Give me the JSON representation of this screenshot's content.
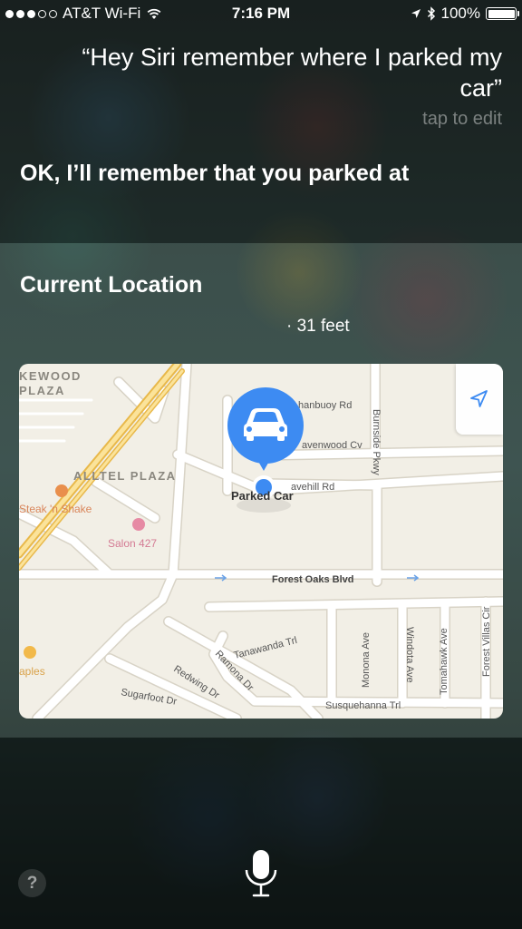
{
  "status_bar": {
    "carrier": "AT&T Wi-Fi",
    "time": "7:16 PM",
    "battery": "100%",
    "signal_bars_filled": 3,
    "signal_bars_total": 5
  },
  "siri": {
    "query": "“Hey Siri remember where I parked my car”",
    "tap_to_edit": "tap to edit",
    "response": "OK, I’ll remember that you parked at"
  },
  "card": {
    "title": "Current Location",
    "distance": "· 31 feet"
  },
  "map": {
    "labels": {
      "kewood": "KEWOOD",
      "plaza_partial": "PLAZA",
      "alltel_plaza": "ALLTEL PLAZA",
      "steak_n_shake": "Steak 'n Shake",
      "salon": "Salon 427",
      "staples_partial": "aples",
      "parked_car": "Parked Car",
      "hanbuoy": "hanbuoy Rd",
      "avenwood": "avenwood Cv",
      "avehill": "avehill Rd",
      "burnside": "Burnside Pkwy",
      "forest_oaks": "Forest Oaks Blvd",
      "tanawanda": "Tanawanda Trl",
      "ramona": "Ramona Dr",
      "redwing": "Redwing Dr",
      "sugarfoot": "Sugarfoot Dr",
      "susquehanna": "Susquehanna Trl",
      "monona": "Monona Ave",
      "windota": "Windota Ave",
      "tomahawk": "Tomahawk Ave",
      "forest_villas": "Forest Villas Cir"
    },
    "colors": {
      "pin": "#3d8bf2",
      "land": "#f2efe6",
      "highway": "#f5c94a",
      "poi_text": "#d9855a"
    }
  },
  "icons": {
    "help": "?",
    "mic": "microphone-icon",
    "navigation": "location-arrow-icon",
    "car": "car-icon"
  }
}
